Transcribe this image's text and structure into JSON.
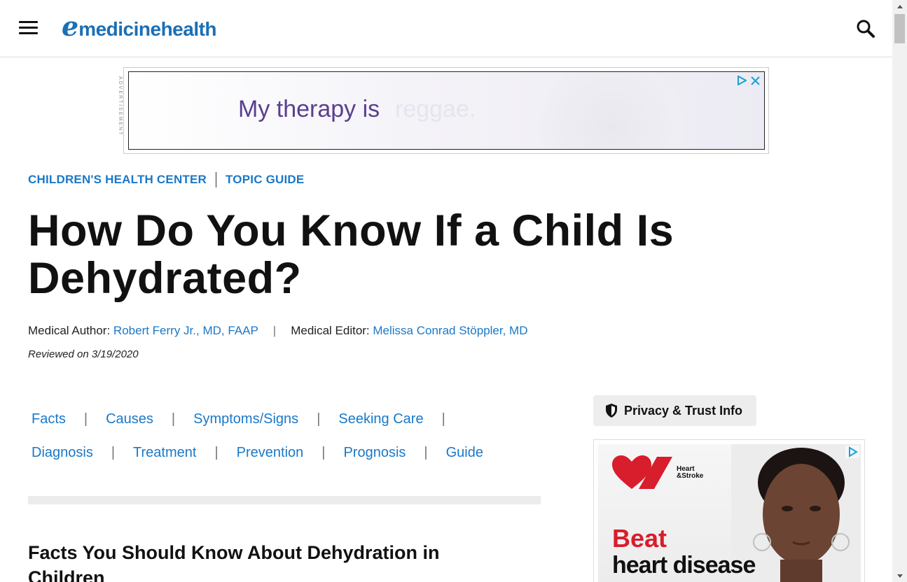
{
  "header": {
    "logo_e": "e",
    "logo_medicine": "medicine",
    "logo_health": "health"
  },
  "top_ad": {
    "label": "ADVERTISEMENT",
    "text": "My therapy is",
    "text_faded": "reggae."
  },
  "breadcrumb": {
    "section": "CHILDREN'S HEALTH CENTER",
    "guide": "TOPIC GUIDE"
  },
  "article": {
    "title": "How Do You Know If a Child Is Dehydrated?",
    "author_label": "Medical Author:",
    "author_name": "Robert Ferry Jr., MD, FAAP",
    "separator": "|",
    "editor_label": "Medical Editor:",
    "editor_name": "Melissa Conrad Stöppler, MD",
    "reviewed": "Reviewed on 3/19/2020",
    "section_title": "Facts You Should Know About Dehydration in Children"
  },
  "toc": {
    "row1": [
      "Facts",
      "Causes",
      "Symptoms/Signs",
      "Seeking Care"
    ],
    "row2": [
      "Diagnosis",
      "Treatment",
      "Prevention",
      "Prognosis",
      "Guide"
    ]
  },
  "privacy": {
    "label": "Privacy & Trust Info"
  },
  "side_ad": {
    "brand_line1": "Heart",
    "brand_line2": "&Stroke",
    "headline1": "Beat",
    "headline2": "heart disease"
  },
  "colors": {
    "brand_blue": "#1b6fb5",
    "link_blue": "#1b78c7",
    "ad_purple": "#5a3f8f",
    "heart_red": "#d81d2c"
  }
}
